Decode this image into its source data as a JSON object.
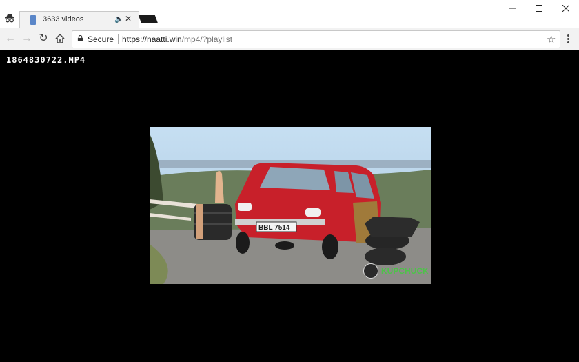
{
  "tab": {
    "title": "3633 videos"
  },
  "address_bar": {
    "security_label": "Secure",
    "url_host": "https://naatti.win",
    "url_path": "/mp4/?playlist"
  },
  "page": {
    "filename": "1864830722.MP4"
  },
  "video": {
    "watermark": "KUPCHUCK",
    "plate": "BBL 7514"
  },
  "colors": {
    "car": "#c8202a",
    "watermark": "#4ec24a"
  }
}
